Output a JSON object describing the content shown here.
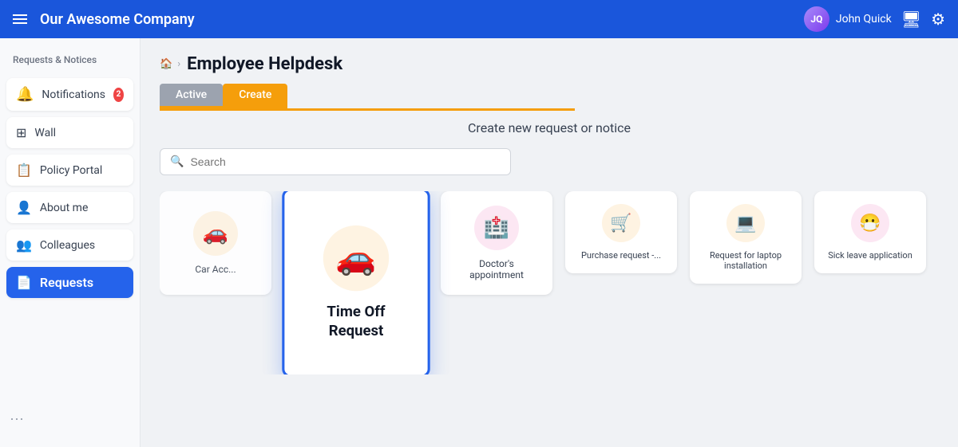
{
  "topnav": {
    "company_name": "Our Awesome Company",
    "user_name": "John Quick",
    "hamburger_label": "menu"
  },
  "sidebar": {
    "section_label": "Requests & Notices",
    "items": [
      {
        "id": "notifications",
        "label": "Notifications",
        "badge": "2",
        "icon": "🔔"
      },
      {
        "id": "wall",
        "label": "Wall",
        "icon": "⊞"
      },
      {
        "id": "policy-portal",
        "label": "Policy Portal",
        "icon": "📋"
      },
      {
        "id": "about-me",
        "label": "About me",
        "icon": "👤"
      },
      {
        "id": "colleagues",
        "label": "Colleagues",
        "icon": "👥"
      },
      {
        "id": "requests",
        "label": "Requests",
        "icon": "📄",
        "active": true
      }
    ]
  },
  "breadcrumb": {
    "home": "🏠",
    "separator": "›",
    "current": "Employee Helpdesk"
  },
  "page_title": "Employee Helpdesk",
  "tabs": [
    {
      "id": "active",
      "label": "Active",
      "type": "active"
    },
    {
      "id": "create",
      "label": "Create",
      "type": "create"
    }
  ],
  "create_subtitle": "Create new request or notice",
  "search": {
    "placeholder": "Search"
  },
  "cards": [
    {
      "id": "car-accident",
      "label": "Car Acc...",
      "icon": "🚗",
      "icon_color": "orange",
      "featured": false,
      "partial": true
    },
    {
      "id": "time-off",
      "label": "Time Off\nRequest",
      "icon": "🚗",
      "icon_color": "orange",
      "featured": true
    },
    {
      "id": "doctors-appointment",
      "label": "Doctor's appointment",
      "icon": "🏥",
      "icon_color": "pink",
      "featured": false
    },
    {
      "id": "purchase-request",
      "label": "Purchase request -...",
      "icon": "🛒",
      "icon_color": "orange",
      "featured": false,
      "partial": true
    },
    {
      "id": "laptop-installation",
      "label": "Request for laptop installation",
      "icon": "💻",
      "icon_color": "orange",
      "featured": false,
      "partial": true
    },
    {
      "id": "sick-leave",
      "label": "Sick leave application",
      "icon": "😷",
      "icon_color": "pink",
      "featured": false,
      "partial": true
    }
  ],
  "icons": {
    "hamburger": "☰",
    "home": "⌂",
    "search": "🔍",
    "monitor": "🖥",
    "gear": "⚙"
  }
}
